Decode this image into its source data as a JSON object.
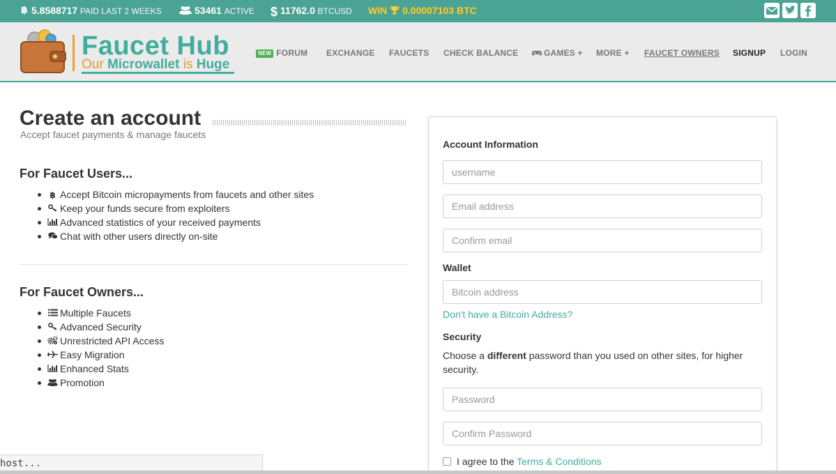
{
  "topbar": {
    "paid_value": "5.8588717",
    "paid_label": "PAID LAST 2 WEEKS",
    "active_value": "53461",
    "active_label": "ACTIVE",
    "price_value": "11762.0",
    "price_label": "BTCUSD",
    "win_prefix": "WIN",
    "win_value": "0.00007103 BTC",
    "icons": [
      "bitcoin-icon",
      "users-icon",
      "dollar-icon",
      "trophy-icon",
      "envelope-icon",
      "twitter-icon",
      "facebook-icon"
    ]
  },
  "brand": {
    "title": "Faucet Hub",
    "tagline_1": "Our ",
    "tagline_2": "Microwallet",
    "tagline_3": " is ",
    "tagline_4": "Huge",
    "colors": {
      "teal": "#41ad9c",
      "orange": "#e69a2e",
      "bar": "#4aa394"
    }
  },
  "nav": {
    "new_badge": "NEW",
    "forum": "FORUM",
    "exchange": "EXCHANGE",
    "faucets": "FAUCETS",
    "check_balance": "CHECK BALANCE",
    "games": "GAMES +",
    "more": "MORE +",
    "faucet_owners": "FAUCET OWNERS",
    "signup": "SIGNUP",
    "login": "LOGIN"
  },
  "intro": {
    "title": "Create an account",
    "subtitle": "Accept faucet payments & manage faucets"
  },
  "users_section": {
    "title": "For Faucet Users...",
    "items": [
      {
        "icon": "bitcoin-icon",
        "text": "Accept Bitcoin micropayments from faucets and other sites"
      },
      {
        "icon": "key-icon",
        "text": "Keep your funds secure from exploiters"
      },
      {
        "icon": "bar-chart-icon",
        "text": "Advanced statistics of your received payments"
      },
      {
        "icon": "comments-icon",
        "text": "Chat with other users directly on-site"
      }
    ]
  },
  "owners_section": {
    "title": "For Faucet Owners...",
    "items": [
      {
        "icon": "list-icon",
        "text": "Multiple Faucets"
      },
      {
        "icon": "key-icon",
        "text": "Advanced Security"
      },
      {
        "icon": "gears-icon",
        "text": "Unrestricted API Access"
      },
      {
        "icon": "plane-icon",
        "text": "Easy Migration"
      },
      {
        "icon": "bar-chart-icon",
        "text": "Enhanced Stats"
      },
      {
        "icon": "users-icon",
        "text": "Promotion"
      }
    ]
  },
  "form": {
    "account_label": "Account Information",
    "username_placeholder": "username",
    "email_placeholder": "Email address",
    "confirm_email_placeholder": "Confirm email",
    "wallet_label": "Wallet",
    "bitcoin_placeholder": "Bitcoin address",
    "no_address_link": "Don't have a Bitcoin Address?",
    "security_label": "Security",
    "security_text_1": "Choose a ",
    "security_text_bold": "different",
    "security_text_2": " password than you used on other sites, for higher security.",
    "password_placeholder": "Password",
    "confirm_password_placeholder": "Confirm Password",
    "agree_text": "I agree to the ",
    "terms_link": "Terms & Conditions"
  },
  "status": {
    "text": "host..."
  }
}
